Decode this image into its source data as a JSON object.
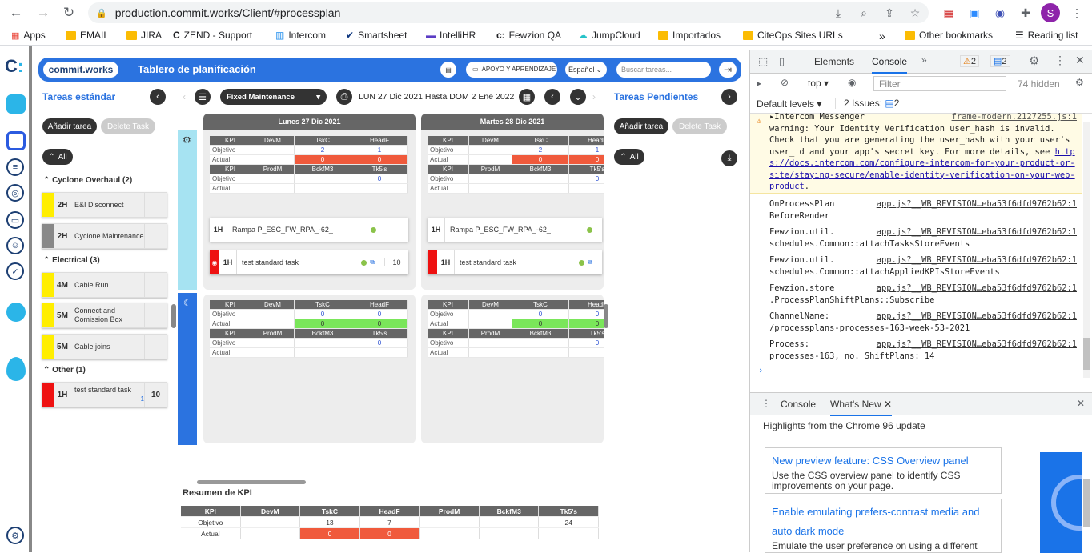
{
  "browser": {
    "url": "production.commit.works/Client/#processplan",
    "profile_initial": "S"
  },
  "bookmarks": [
    "Apps",
    "EMAIL",
    "JIRA",
    "ZEND - Support",
    "Intercom",
    "Smartsheet",
    "IntelliHR",
    "Fewzion QA",
    "JumpCloud",
    "Importados",
    "CiteOps Sites URLs"
  ],
  "bookmarks_right": {
    "more": "»",
    "other": "Other bookmarks",
    "reading": "Reading list"
  },
  "app": {
    "logo": "commit.works",
    "title": "Tablero de planificación",
    "help_label": "APOYO Y APRENDIZAJE",
    "language": "Español",
    "search_placeholder": "Buscar tareas..."
  },
  "left_panel": {
    "title": "Tareas estándar",
    "add_label": "Añadir tarea",
    "delete_label": "Delete Task",
    "all_label": "All",
    "groups": [
      {
        "title": "Cyclone Overhaul (2)",
        "tasks": [
          {
            "dur": "2H",
            "name": "E&I Disconnect",
            "color": "#ffee00",
            "count": ""
          },
          {
            "dur": "2H",
            "name": "Cyclone Maintenance",
            "color": "#888888",
            "count": ""
          }
        ]
      },
      {
        "title": "Electrical (3)",
        "tasks": [
          {
            "dur": "4M",
            "name": "Cable Run",
            "color": "#ffee00",
            "count": ""
          },
          {
            "dur": "5M",
            "name": "Connect and Comission Box",
            "color": "#ffee00",
            "count": ""
          },
          {
            "dur": "5M",
            "name": "Cable joins",
            "color": "#ffee00",
            "count": ""
          }
        ]
      },
      {
        "title": "Other (1)",
        "tasks": [
          {
            "dur": "1H",
            "name": "test standard task",
            "color": "#ee1111",
            "count": "10",
            "sub": "1"
          }
        ]
      }
    ]
  },
  "center": {
    "plan": "Fixed Maintenance",
    "date_range": "LUN 27 Dic 2021 Hasta DOM 2 Ene 2022",
    "days": [
      "Lunes 27 Dic 2021",
      "Martes 28 Dic 2021"
    ],
    "kpi_headers_1": [
      "KPI",
      "DevM",
      "TskC",
      "HeadF"
    ],
    "kpi_headers_2": [
      "KPI",
      "ProdM",
      "BckfM3",
      "Tk5's"
    ],
    "row_objetivo": "Objetivo",
    "row_actual": "Actual",
    "day_shift": {
      "objetivo_1": [
        "",
        "2",
        "1"
      ],
      "actual_1": [
        "",
        "0",
        "0"
      ],
      "objetivo_2": [
        "",
        "",
        "0"
      ],
      "actual_2": [
        "",
        "",
        ""
      ]
    },
    "night_shift": {
      "objetivo_1": [
        "",
        "0",
        "0"
      ],
      "actual_1": [
        "",
        "0",
        "0"
      ],
      "objetivo_2": [
        "",
        "",
        "0"
      ],
      "actual_2": [
        "",
        "",
        ""
      ]
    },
    "tasks": [
      {
        "dur": "1H",
        "name": "Rampa P_ESC_FW_RPA_-62_"
      },
      {
        "dur": "1H",
        "name": "test standard task",
        "count": "10"
      }
    ]
  },
  "right_panel": {
    "title": "Tareas Pendientes",
    "add_label": "Añadir tarea",
    "delete_label": "Delete Task",
    "all_label": "All"
  },
  "summary": {
    "title": "Resumen de KPI",
    "headers": [
      "KPI",
      "DevM",
      "TskC",
      "HeadF",
      "ProdM",
      "BckfM3",
      "Tk5's"
    ],
    "objetivo": [
      "Objetivo",
      "",
      "13",
      "7",
      "",
      "",
      "24"
    ],
    "actual": [
      "Actual",
      "",
      "0",
      "0",
      "",
      "",
      ""
    ]
  },
  "devtools": {
    "tabs": [
      "Elements",
      "Console"
    ],
    "warn_count": "2",
    "msg_count": "2",
    "context": "top",
    "filter_placeholder": "Filter",
    "hidden": "74 hidden",
    "levels": "Default levels",
    "issues": "2 Issues:",
    "issues_count": "2",
    "warning": {
      "head": "Intercom Messenger",
      "src": "frame-modern.2127255.js:1",
      "text": "warning: Your Identity Verification user_hash is invalid. Check that you are generating the user_hash with your user's user_id and your app's secret key. For more details, see",
      "link": "https://docs.intercom.com/configure-intercom-for-your-product-or-site/staying-secure/enable-identity-verification-on-your-web-product",
      "tail": "."
    },
    "logs": [
      {
        "a": "OnProcessPlan",
        "src": "app.js?__WB_REVISION…eba53f6dfd9762b62:1",
        "b": "BeforeRender"
      },
      {
        "a": "Fewzion.util.",
        "src": "app.js?__WB_REVISION…eba53f6dfd9762b62:1",
        "b": "schedules.Common::attachTasksStoreEvents"
      },
      {
        "a": "Fewzion.util.",
        "src": "app.js?__WB_REVISION…eba53f6dfd9762b62:1",
        "b": "schedules.Common::attachAppliedKPIsStoreEvents"
      },
      {
        "a": "Fewzion.store",
        "src": "app.js?__WB_REVISION…eba53f6dfd9762b62:1",
        "b": ".ProcessPlanShiftPlans::Subscribe"
      },
      {
        "a": "ChannelName:",
        "src": "app.js?__WB_REVISION…eba53f6dfd9762b62:1",
        "b": "/processplans-processes-163-week-53-2021"
      },
      {
        "a": "Process:",
        "src": "app.js?__WB_REVISION…eba53f6dfd9762b62:1",
        "b": "processes-163, no. ShiftPlans: 14"
      }
    ],
    "drawer_tabs": [
      "Console",
      "What's New"
    ],
    "highlights": "Highlights from the Chrome 96 update",
    "cards": [
      {
        "title": "New preview feature: CSS Overview panel",
        "body": "Use the CSS overview panel to identify CSS improvements on your page."
      },
      {
        "title": "Enable emulating prefers-contrast media and auto dark mode",
        "body": "Emulate the user preference on using a different"
      }
    ]
  }
}
